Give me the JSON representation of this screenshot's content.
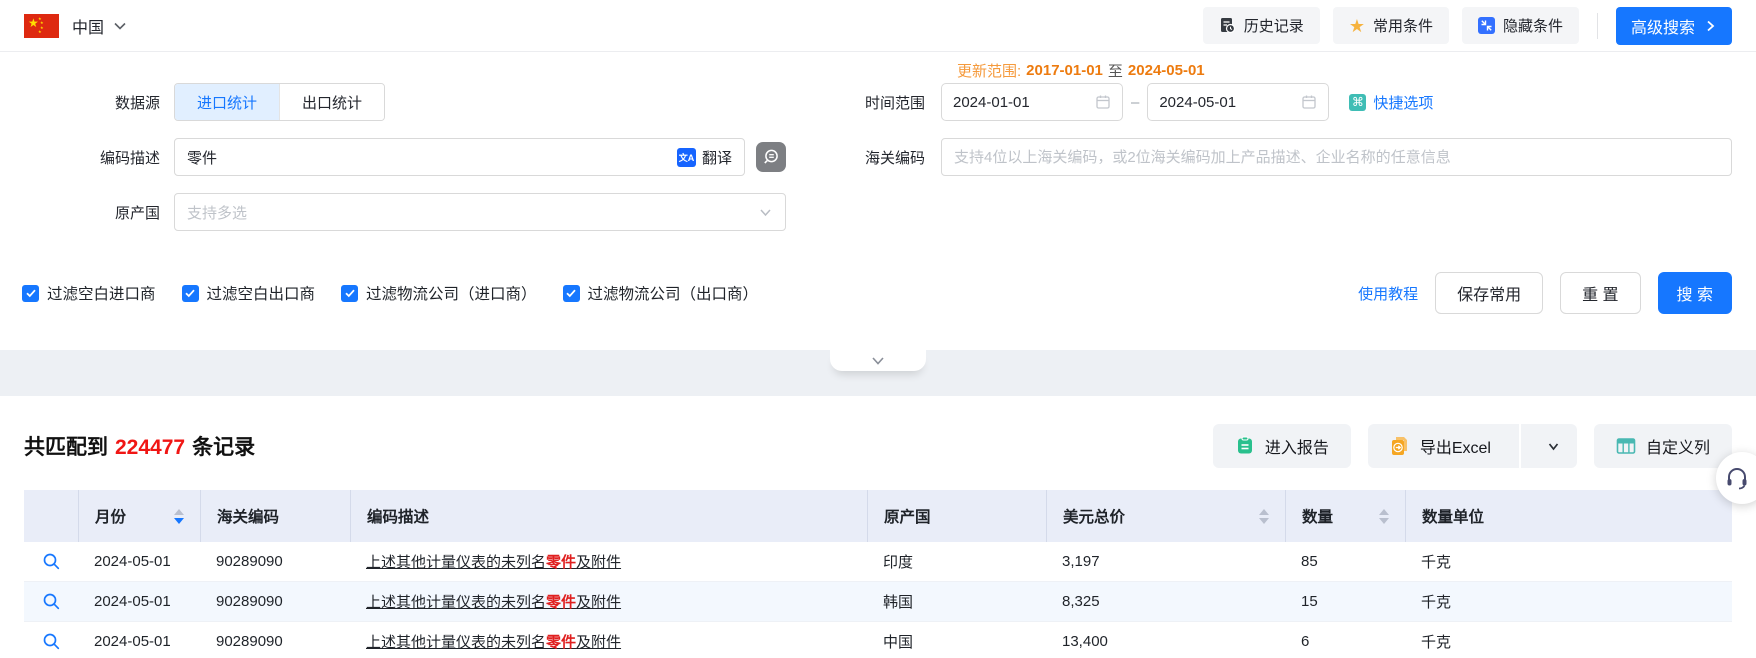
{
  "topbar": {
    "country": "中国",
    "history_label": "历史记录",
    "favorites_label": "常用条件",
    "hide_label": "隐藏条件",
    "advanced_label": "高级搜索"
  },
  "search": {
    "update_range_label": "更新范围:",
    "update_start": "2017-01-01",
    "update_to": "至",
    "update_end": "2024-05-01",
    "data_source_label": "数据源",
    "tab_import": "进口统计",
    "tab_export": "出口统计",
    "time_range_label": "时间范围",
    "date_start": "2024-01-01",
    "date_separator": "–",
    "date_end": "2024-05-01",
    "quick_options_label": "快捷选项",
    "code_desc_label": "编码描述",
    "code_desc_value": "零件",
    "translate_label": "翻译",
    "hs_code_label": "海关编码",
    "hs_code_placeholder": "支持4位以上海关编码，或2位海关编码加上产品描述、企业名称的任意信息",
    "origin_label": "原产国",
    "origin_placeholder": "支持多选",
    "checkboxes": [
      "过滤空白进口商",
      "过滤空白出口商",
      "过滤物流公司（进口商）",
      "过滤物流公司（出口商）"
    ],
    "tutorial_link": "使用教程",
    "save_button": "保存常用",
    "reset_button": "重 置",
    "search_button": "搜 索"
  },
  "results": {
    "title_prefix": "共匹配到",
    "count": "224477",
    "title_suffix": "条记录",
    "report_button": "进入报告",
    "export_button": "导出Excel",
    "custom_columns_button": "自定义列"
  },
  "table": {
    "headers": [
      "月份",
      "海关编码",
      "编码描述",
      "原产国",
      "美元总价",
      "数量",
      "数量单位"
    ],
    "rows": [
      {
        "month": "2024-05-01",
        "hs_code": "90289090",
        "desc_pre": "上述其他计量仪表的未列名",
        "desc_highlight": "零件",
        "desc_post": "及附件",
        "origin": "印度",
        "usd_total": "3,197",
        "quantity": "85",
        "unit": "千克"
      },
      {
        "month": "2024-05-01",
        "hs_code": "90289090",
        "desc_pre": "上述其他计量仪表的未列名",
        "desc_highlight": "零件",
        "desc_post": "及附件",
        "origin": "韩国",
        "usd_total": "8,325",
        "quantity": "15",
        "unit": "千克"
      },
      {
        "month": "2024-05-01",
        "hs_code": "90289090",
        "desc_pre": "上述其他计量仪表的未列名",
        "desc_highlight": "零件",
        "desc_post": "及附件",
        "origin": "中国",
        "usd_total": "13,400",
        "quantity": "6",
        "unit": "千克"
      }
    ]
  },
  "colors": {
    "accent_blue": "#1677ff",
    "highlight_red": "#f01614",
    "update_orange": "#ed7b0f",
    "header_bg": "#e9edf8",
    "teal_icon": "#3fbdb5",
    "export_orange": "#f5a623"
  }
}
